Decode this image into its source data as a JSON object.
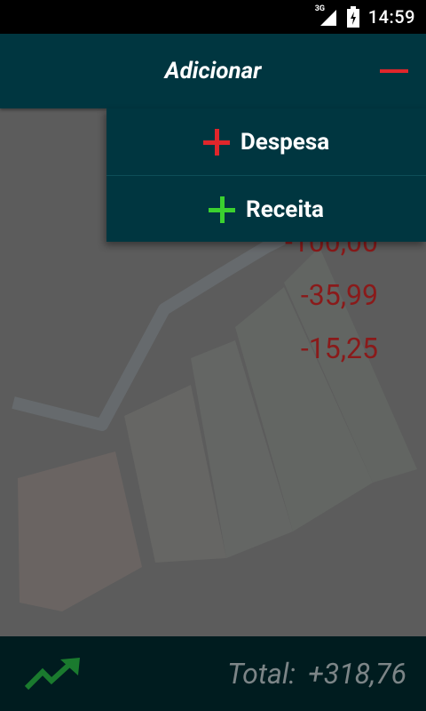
{
  "status_bar": {
    "network": "3G",
    "time": "14:59"
  },
  "header": {
    "title": "Adicionar"
  },
  "menu": {
    "items": [
      {
        "label": "Despesa",
        "icon": "plus-icon",
        "color": "#e0262b"
      },
      {
        "label": "Receita",
        "icon": "plus-icon",
        "color": "#3bd12f"
      }
    ]
  },
  "transactions": {
    "amounts": [
      "-100,00",
      "-35,99",
      "-15,25"
    ],
    "amount_color": "#8a1a1a"
  },
  "footer": {
    "total_label": "Total:",
    "total_value": "+318,76",
    "trend_icon": "trending-up-icon",
    "trend_color": "#1a7a2e"
  },
  "colors": {
    "toolbar": "#003640",
    "footer": "#001c1f",
    "accent_red": "#e0262b",
    "accent_green": "#3bd12f"
  }
}
